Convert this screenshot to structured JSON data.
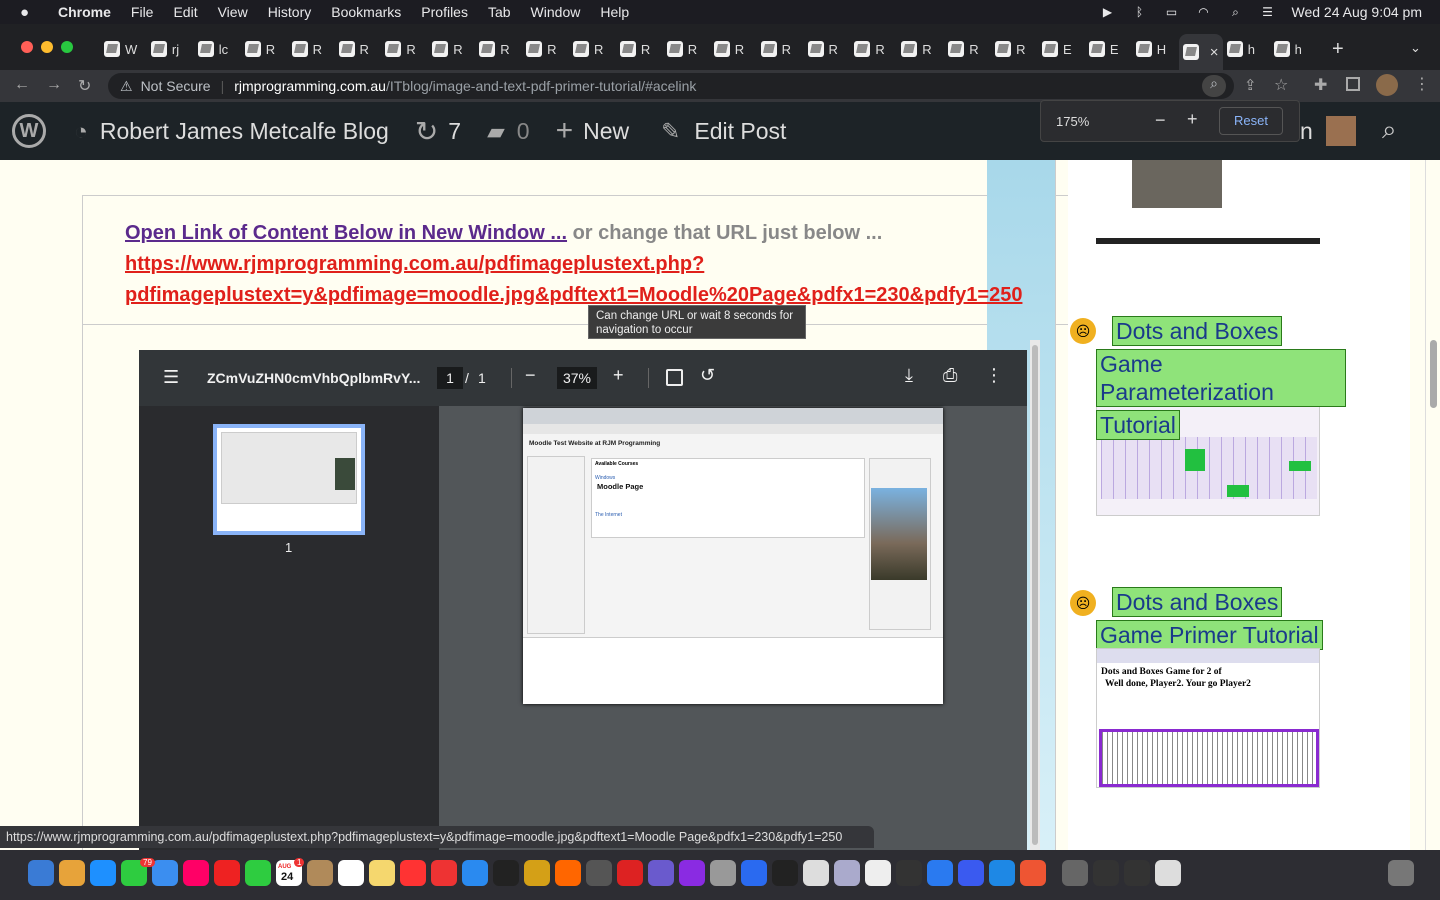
{
  "menubar": {
    "apple": "",
    "items": [
      "Chrome",
      "File",
      "Edit",
      "View",
      "History",
      "Bookmarks",
      "Profiles",
      "Tab",
      "Window",
      "Help"
    ],
    "clock": "Wed 24 Aug  9:04 pm"
  },
  "tabs": {
    "labels": [
      "W",
      "rj",
      "lc",
      "R",
      "R",
      "R",
      "R",
      "R",
      "R",
      "R",
      "R",
      "R",
      "R",
      "R",
      "R",
      "R",
      "R",
      "R",
      "R",
      "R",
      "E",
      "E",
      "H",
      "",
      "h",
      "h"
    ],
    "new_tab": "+"
  },
  "address": {
    "security": "Not Secure",
    "host": "rjmprogramming.com.au",
    "path": "/ITblog/image-and-text-pdf-primer-tutorial/#acelink"
  },
  "zoom": {
    "level": "175%",
    "minus": "−",
    "plus": "+",
    "reset": "Reset"
  },
  "wpbar": {
    "site": "Robert James Metcalfe Blog",
    "updates": "7",
    "comments": "0",
    "new": "New",
    "edit": "Edit Post",
    "user_fragment": "n"
  },
  "content": {
    "open_link": "Open Link of Content Below in New Window ...",
    "or_change": " or change that URL just below ...",
    "url_line1": "https://www.rjmprogramming.com.au/pdfimageplustext.php?",
    "url_line2": "pdfimageplustext=y&pdfimage=moodle.jpg&pdftext1=Moodle%20Page&pdfx1=230&pdfy1=250",
    "tooltip": "Can change URL or wait 8 seconds for navigation to occur"
  },
  "pdf": {
    "filename": "ZCmVuZHN0cmVhbQplbmRvY...",
    "page": "1",
    "pages": "1",
    "page_sep": "/",
    "zoom": "37%",
    "thumb_label": "1",
    "page_title": "Moodle Test Website at RJM Programming",
    "page_heading": "Available Courses",
    "course1": "Windows",
    "course1_name": "Moodle Page",
    "course2": "The Internet"
  },
  "sidebar": {
    "post1_title_lines": [
      "Dots and Boxes",
      "Game Parameterization",
      "Tutorial"
    ],
    "post2_title_lines": [
      "Dots and Boxes",
      "Game Primer Tutorial"
    ],
    "post2_img_text": "Dots and Boxes Game for 2 of",
    "post2_img_text2": "Well done, Player2. Your go Player2"
  },
  "statusbar": {
    "url": "https://www.rjmprogramming.com.au/pdfimageplustext.php?pdfimageplustext=y&pdfimage=moodle.jpg&pdftext1=Moodle Page&pdfx1=230&pdfy1=250"
  },
  "dock": {
    "badge_messages": "79",
    "badge_calendar": "1",
    "calendar_day": "24",
    "calendar_month": "AUG"
  },
  "colors": {
    "menubar": "#1c1c22",
    "tabstrip": "#202124",
    "wpbar": "#1d2327",
    "link_purple": "#5b2a8c",
    "link_red": "#e0201a",
    "highlight_green": "#8fe37a",
    "pdf_viewer": "#525659"
  }
}
